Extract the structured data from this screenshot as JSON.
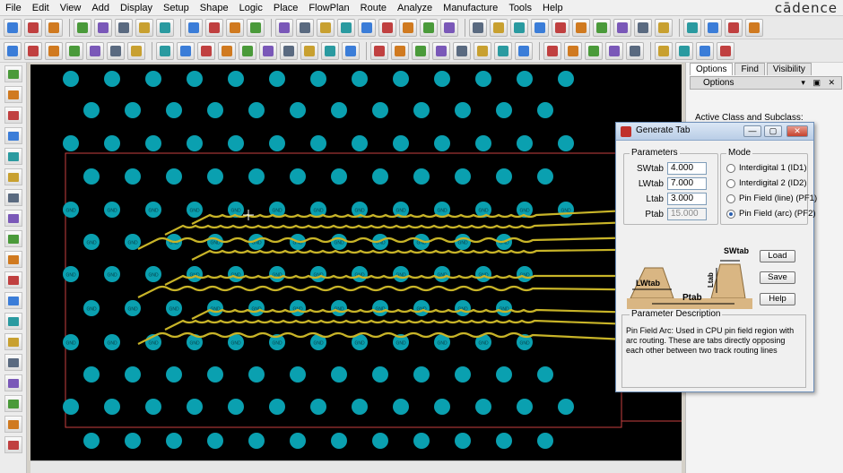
{
  "menu": {
    "items": [
      "File",
      "Edit",
      "View",
      "Add",
      "Display",
      "Setup",
      "Shape",
      "Logic",
      "Place",
      "FlowPlan",
      "Route",
      "Analyze",
      "Manufacture",
      "Tools",
      "Help"
    ],
    "brand": "cādence"
  },
  "right_panel": {
    "tabs": [
      "Options",
      "Find",
      "Visibility"
    ],
    "header": "Options",
    "header_controls": "▾ ▣ ✕",
    "active_class_label": "Active Class and Subclass:"
  },
  "dialog": {
    "title": "Generate Tab",
    "window_controls": [
      "—",
      "▢",
      "✕"
    ],
    "parameters": {
      "label": "Parameters",
      "rows": [
        {
          "label": "SWtab",
          "value": "4.000"
        },
        {
          "label": "LWtab",
          "value": "7.000"
        },
        {
          "label": "Ltab",
          "value": "3.000"
        },
        {
          "label": "Ptab",
          "value": "15.000"
        }
      ]
    },
    "mode": {
      "label": "Mode",
      "options": [
        {
          "label": "Interdigital 1  (ID1)",
          "selected": false
        },
        {
          "label": "Interdigital 2  (ID2)",
          "selected": false
        },
        {
          "label": "Pin Field (line) (PF1)",
          "selected": false
        },
        {
          "label": "Pin Field (arc) (PF2)",
          "selected": true
        }
      ]
    },
    "diagram": {
      "swtab": "SWtab",
      "lwtab": "LWtab",
      "ptab": "Ptab",
      "ltab": "Ltab"
    },
    "buttons": {
      "load": "Load",
      "save": "Save",
      "help": "Help"
    },
    "description": {
      "label": "Parameter Description",
      "text": "Pin Field Arc: Used in CPU pin field region with arc routing. These are tabs directly opposing each other between two track routing lines"
    }
  },
  "colors": {
    "canvas_bg": "#000000",
    "pad": "#0aa0b0",
    "trace": "#c8b428",
    "board_outline": "#c84040"
  },
  "pad_label": "GND"
}
